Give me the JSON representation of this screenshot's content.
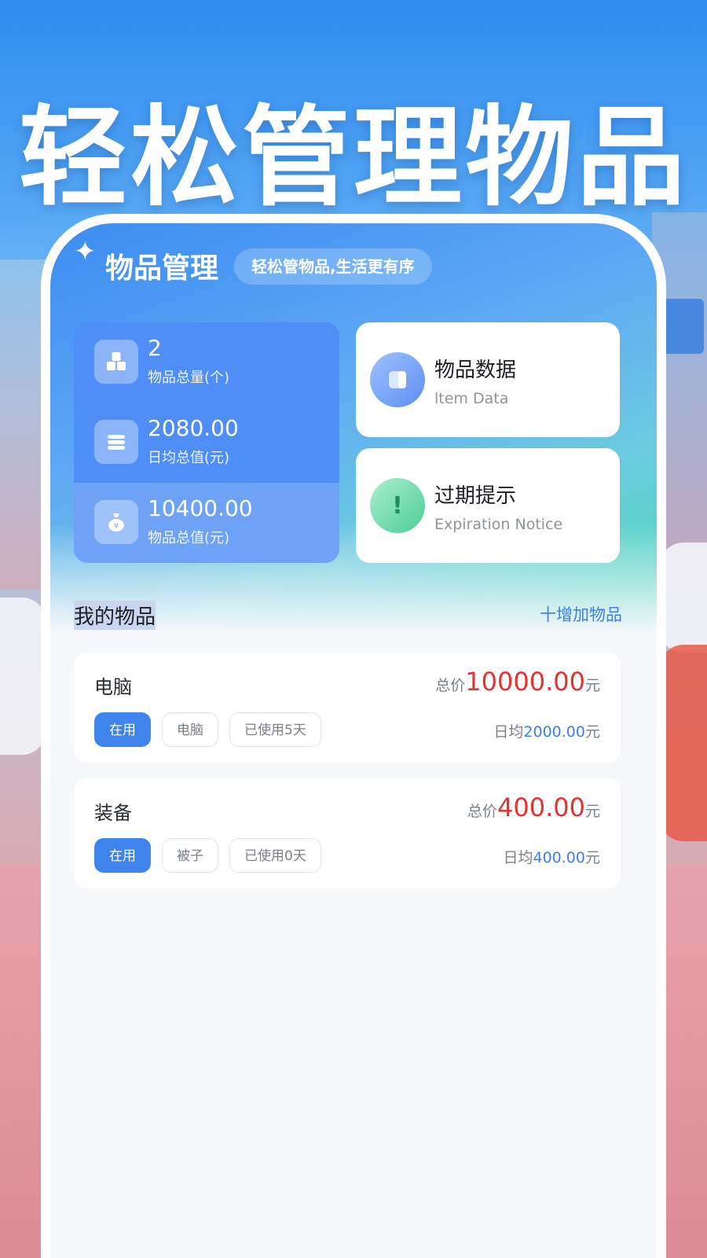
{
  "headline": "轻松管理物品",
  "app": {
    "title": "物品管理",
    "slogan": "轻松管物品,生活更有序"
  },
  "stats": [
    {
      "value": "2",
      "label": "物品总量(个)",
      "icon": "boxes-icon"
    },
    {
      "value": "2080.00",
      "label": "日均总值(元)",
      "icon": "coin-stack-icon"
    },
    {
      "value": "10400.00",
      "label": "物品总值(元)",
      "icon": "money-bag-icon"
    }
  ],
  "features": [
    {
      "title": "物品数据",
      "subtitle": "ltem Data",
      "icon": "document-icon"
    },
    {
      "title": "过期提示",
      "subtitle": "Expiration Notice",
      "icon": "alert-icon"
    }
  ],
  "section": {
    "title": "我的物品",
    "add_label": "十增加物品"
  },
  "items": [
    {
      "name": "电脑",
      "total_prefix": "总价",
      "total_price": "10000.00",
      "total_unit": "元",
      "tags": [
        "在用",
        "电脑",
        "已使用5天"
      ],
      "daily_prefix": "日均",
      "daily_price": "2000.00",
      "daily_unit": "元"
    },
    {
      "name": "装备",
      "total_prefix": "总价",
      "total_price": "400.00",
      "total_unit": "元",
      "tags": [
        "在用",
        "被子",
        "已使用0天"
      ],
      "daily_prefix": "日均",
      "daily_price": "400.00",
      "daily_unit": "元"
    }
  ],
  "colors": {
    "primary": "#3e84ec",
    "price_red": "#e0342f",
    "stats_card": "#4f8ef6"
  }
}
